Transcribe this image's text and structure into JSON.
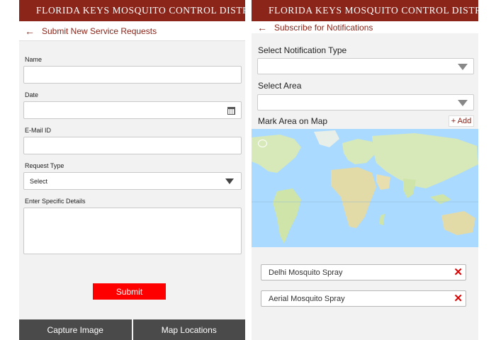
{
  "left": {
    "appbar": {
      "title": "FLORIDA KEYS MOSQUITO CONTROL DISTRICT"
    },
    "subbar": {
      "back": "←",
      "title": "Submit New Service Requests"
    },
    "form": {
      "name_label": "Name",
      "name_value": "",
      "date_label": "Date",
      "date_value": "",
      "email_label": "E-Mail ID",
      "email_value": "",
      "request_type_label": "Request Type",
      "request_type_selected": "Select",
      "details_label": "Enter Specific Details",
      "details_value": ""
    },
    "submit_label": "Submit",
    "bottom": {
      "capture_label": "Capture Image",
      "map_label": "Map Locations"
    }
  },
  "right": {
    "appbar": {
      "title": "FLORIDA KEYS MOSQUITO CONTROL DISTRICT"
    },
    "subbar": {
      "back": "←",
      "title": "Subscribe for Notifications"
    },
    "notification_type_label": "Select Notification Type",
    "area_label": "Select Area",
    "mark_area_label": "Mark Area on Map",
    "add_label": "+ Add",
    "chips": [
      {
        "label": "Delhi Mosquito Spray",
        "remove": "✕"
      },
      {
        "label": "Aerial Mosquito Spray",
        "remove": "✕"
      }
    ]
  },
  "colors": {
    "brand": "#8b2419",
    "submit": "#ff0000",
    "bottom_bar": "#4a4a4a",
    "map_water": "#aadaff",
    "map_land": "#d7e9b8",
    "remove": "#e00000"
  },
  "icons": [
    "menu-icon",
    "back-arrow-icon",
    "calendar-icon",
    "dropdown-caret-icon",
    "map-icon",
    "remove-icon"
  ]
}
